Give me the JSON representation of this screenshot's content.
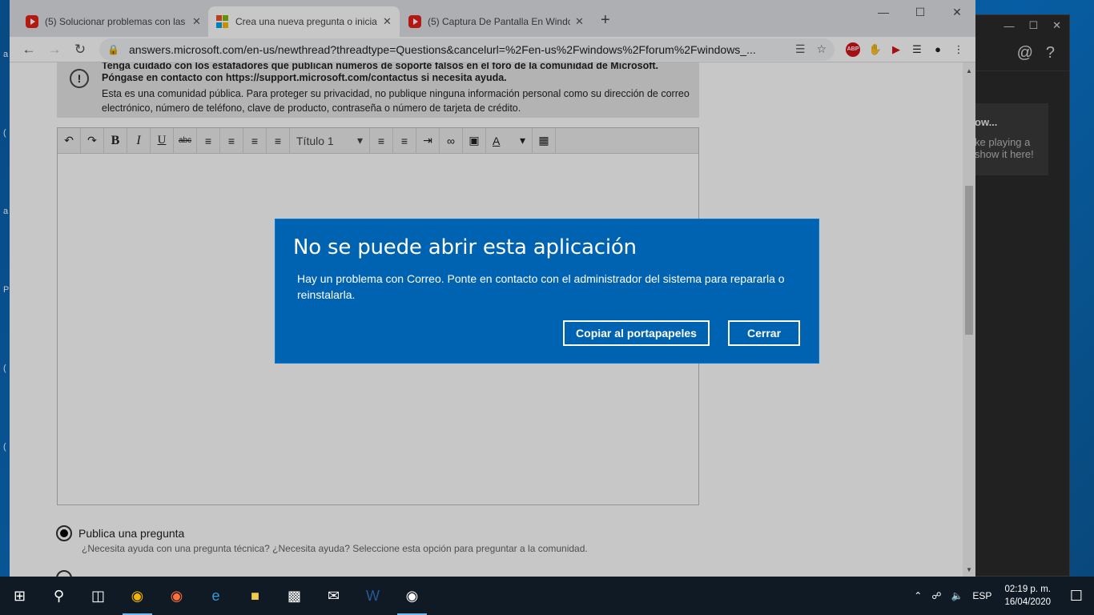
{
  "tabs": [
    {
      "title": "(5) Solucionar problemas con las",
      "favicon": "youtube-icon"
    },
    {
      "title": "Crea una nueva pregunta o inicia",
      "favicon": "microsoft-icon"
    },
    {
      "title": "(5) Captura De Pantalla En Windo",
      "favicon": "youtube-icon"
    }
  ],
  "address": {
    "url": "answers.microsoft.com/en-us/newthread?threadtype=Questions&cancelurl=%2Fen-us%2Fwindows%2Fforum%2Fwindows_..."
  },
  "notice": {
    "line1": "Tenga cuidado con los estafadores que publican números de soporte falsos en el foro de la comunidad de Microsoft.",
    "line2": "Póngase en contacto con https://support.microsoft.com/contactus si necesita ayuda.",
    "line3": "Esta es una comunidad pública. Para proteger su privacidad, no publique ninguna información personal como su dirección de correo electrónico, número de teléfono, clave de producto, contraseña o número de tarjeta de crédito."
  },
  "editor": {
    "heading_select": "Título 1"
  },
  "post_type": {
    "option1_label": "Publica una pregunta",
    "option1_desc": "¿Necesita ayuda con una pregunta técnica? ¿Necesita ayuda? Seleccione esta opción para preguntar a la comunidad."
  },
  "dialog": {
    "title": "No se puede abrir esta aplicación",
    "message": "Hay un problema con Correo. Ponte en contacto con el administrador del sistema para repararla o reinstalarla.",
    "copy_button": "Copiar al portapapeles",
    "close_button": "Cerrar"
  },
  "background_app": {
    "card_title": "ow...",
    "card_text": "ke playing a show it here!"
  },
  "taskbar": {
    "language": "ESP",
    "time": "02:19 p. m.",
    "date": "16/04/2020"
  },
  "colors": {
    "dialog_bg": "#0063b1",
    "taskbar_bg": "#101a24"
  }
}
